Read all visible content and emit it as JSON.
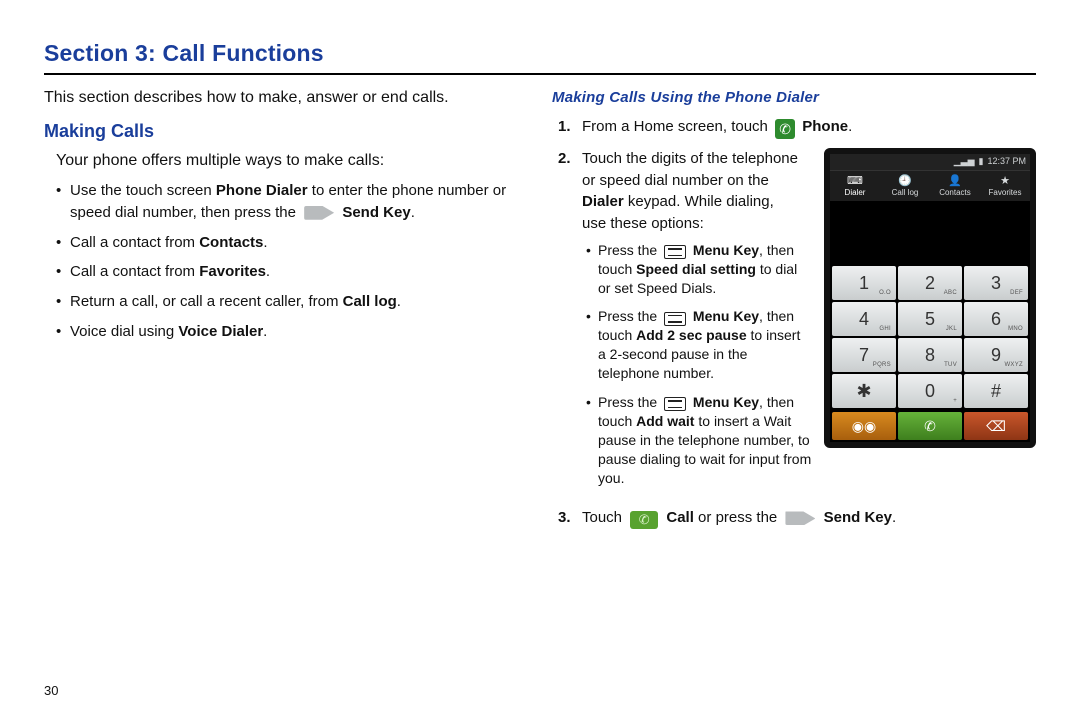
{
  "section_title": "Section 3: Call Functions",
  "page_number": "30",
  "left": {
    "intro": "This section describes how to make, answer or end calls.",
    "heading": "Making Calls",
    "lead": "Your phone offers multiple ways to make calls:",
    "bullets": {
      "b1a": "Use the touch screen ",
      "b1b": "Phone Dialer",
      "b1c": " to enter the phone number or speed dial number, then press the ",
      "b1d": "Send Key",
      "b1e": ".",
      "b2a": "Call a contact from ",
      "b2b": "Contacts",
      "b2c": ".",
      "b3a": "Call a contact from ",
      "b3b": "Favorites",
      "b3c": ".",
      "b4a": "Return a call, or call a recent caller, from ",
      "b4b": "Call log",
      "b4c": ".",
      "b5a": "Voice dial using ",
      "b5b": "Voice Dialer",
      "b5c": "."
    }
  },
  "right": {
    "heading": "Making Calls Using the Phone Dialer",
    "step1": {
      "a": "From a Home screen, touch ",
      "b": "Phone",
      "c": "."
    },
    "step2": {
      "a": "Touch the digits of the telephone or speed dial number on the ",
      "b": "Dialer",
      "c": " keypad. While dialing, use these options:",
      "s1a": "Press the ",
      "s1b": "Menu Key",
      "s1c": ", then touch ",
      "s1d": "Speed dial setting",
      "s1e": " to dial or set Speed Dials.",
      "s2a": "Press the ",
      "s2b": "Menu Key",
      "s2c": ", then touch ",
      "s2d": "Add 2 sec pause",
      "s2e": " to insert a 2-second pause in the telephone number.",
      "s3a": "Press the ",
      "s3b": "Menu Key",
      "s3c": ", then touch ",
      "s3d": "Add wait",
      "s3e": " to insert a Wait pause in the telephone number, to pause dialing to wait for input from you."
    },
    "step3": {
      "a": "Touch ",
      "b": "Call",
      "c": " or press the ",
      "d": "Send Key",
      "e": "."
    }
  },
  "phone": {
    "time": "12:37 PM",
    "tabs": [
      "Dialer",
      "Call log",
      "Contacts",
      "Favorites"
    ],
    "keys": [
      {
        "d": "1",
        "s": "O.O"
      },
      {
        "d": "2",
        "s": "ABC"
      },
      {
        "d": "3",
        "s": "DEF"
      },
      {
        "d": "4",
        "s": "GHI"
      },
      {
        "d": "5",
        "s": "JKL"
      },
      {
        "d": "6",
        "s": "MNO"
      },
      {
        "d": "7",
        "s": "PQRS"
      },
      {
        "d": "8",
        "s": "TUV"
      },
      {
        "d": "9",
        "s": "WXYZ"
      },
      {
        "d": "✱",
        "s": ""
      },
      {
        "d": "0",
        "s": "+"
      },
      {
        "d": "#",
        "s": ""
      }
    ]
  }
}
